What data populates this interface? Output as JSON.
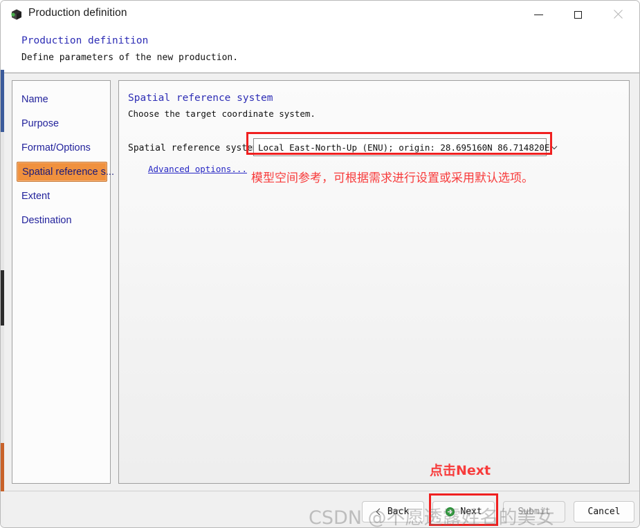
{
  "window": {
    "title": "Production definition",
    "icon": "cube-icon",
    "controls": {
      "minimize": "minimize-icon",
      "maximize": "maximize-icon",
      "close": "close-icon"
    }
  },
  "header": {
    "title": "Production definition",
    "subtitle": "Define parameters of the new production."
  },
  "sidebar": {
    "items": [
      {
        "label": "Name",
        "selected": false
      },
      {
        "label": "Purpose",
        "selected": false
      },
      {
        "label": "Format/Options",
        "selected": false
      },
      {
        "label": "Spatial reference s...",
        "selected": true
      },
      {
        "label": "Extent",
        "selected": false
      },
      {
        "label": "Destination",
        "selected": false
      }
    ]
  },
  "content": {
    "title": "Spatial reference system",
    "subtitle": "Choose the target coordinate system.",
    "field_label": "Spatial reference system:",
    "combo_value": "Local East-North-Up (ENU); origin: 28.695160N 86.714820E",
    "combo_caret": "chevron-down-icon",
    "advanced_link": "Advanced options..."
  },
  "footer": {
    "back_label": "Back",
    "back_icon": "chevron-left-icon",
    "next_label": "Next",
    "next_icon": "green-arrow-right-icon",
    "submit_label": "Submit",
    "cancel_label": "Cancel"
  },
  "annotations": {
    "combo_note": "模型空间参考，可根据需求进行设置或采用默认选项。",
    "next_note": "点击Next",
    "highlight_color": "#f02020"
  },
  "watermark": {
    "text": "CSDN @不愿透露姓名的美女"
  }
}
